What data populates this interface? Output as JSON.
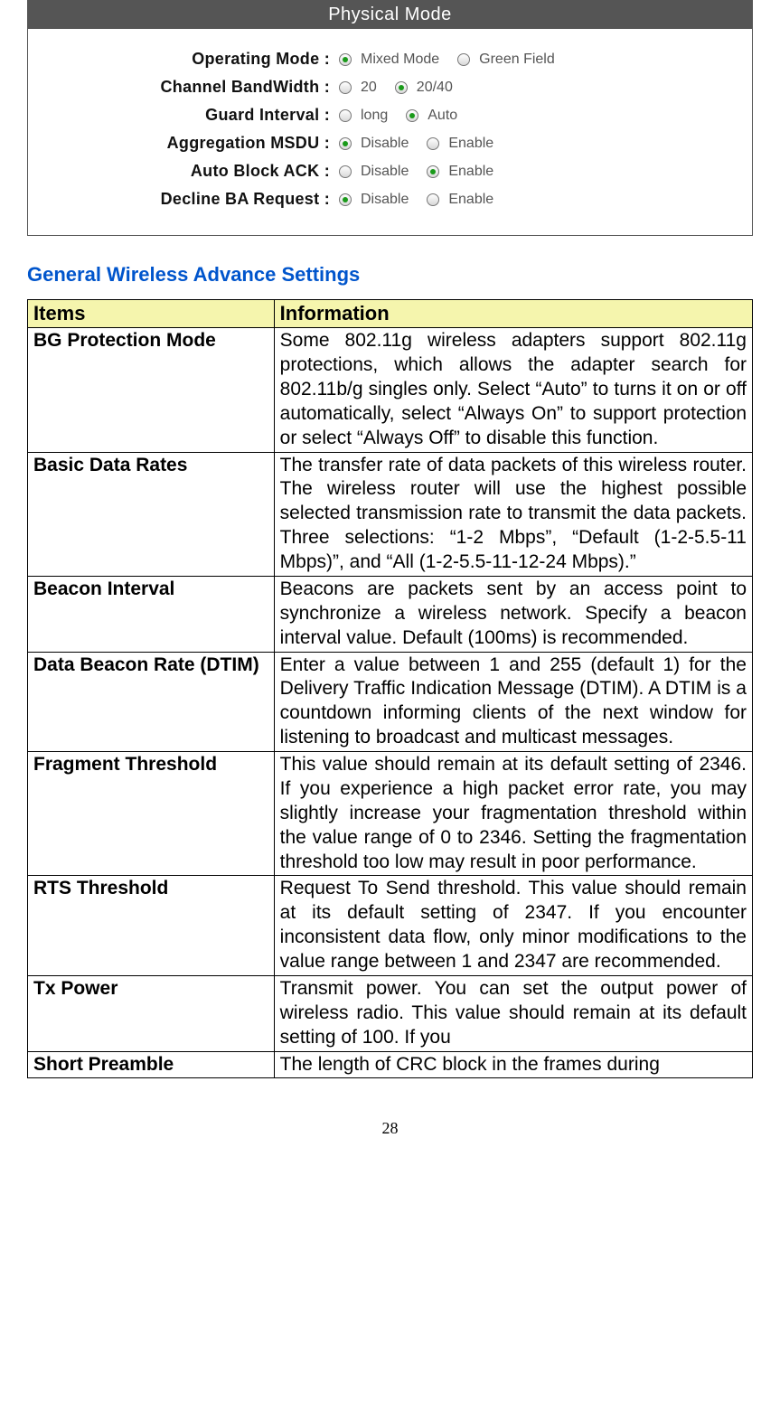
{
  "panel": {
    "title": "Physical Mode",
    "rows": [
      {
        "label": "Operating Mode :",
        "options": [
          {
            "label": "Mixed Mode",
            "checked": true
          },
          {
            "label": "Green Field",
            "checked": false
          }
        ]
      },
      {
        "label": "Channel BandWidth :",
        "options": [
          {
            "label": "20",
            "checked": false
          },
          {
            "label": "20/40",
            "checked": true
          }
        ]
      },
      {
        "label": "Guard Interval :",
        "options": [
          {
            "label": "long",
            "checked": false
          },
          {
            "label": "Auto",
            "checked": true
          }
        ]
      },
      {
        "label": "Aggregation MSDU :",
        "options": [
          {
            "label": "Disable",
            "checked": true
          },
          {
            "label": "Enable",
            "checked": false
          }
        ]
      },
      {
        "label": "Auto Block ACK :",
        "options": [
          {
            "label": "Disable",
            "checked": false
          },
          {
            "label": "Enable",
            "checked": true
          }
        ]
      },
      {
        "label": "Decline BA Request :",
        "options": [
          {
            "label": "Disable",
            "checked": true
          },
          {
            "label": "Enable",
            "checked": false
          }
        ]
      }
    ]
  },
  "section_heading": "General Wireless Advance Settings",
  "table": {
    "headers": {
      "items": "Items",
      "info": "Information"
    },
    "rows": [
      {
        "item": "BG Protection Mode",
        "info": "Some 802.11g wireless adapters support 802.11g protections, which allows the adapter search for 802.11b/g singles only. Select “Auto” to turns it on or off automatically, select “Always On” to support protection or select “Always Off” to disable this function."
      },
      {
        "item": "Basic Data Rates",
        "info": "The transfer rate of data packets of this wireless router. The wireless router will use the highest possible selected transmission rate to transmit the data packets. Three selections: “1-2 Mbps”, “Default (1-2-5.5-11 Mbps)”, and “All (1-2-5.5-11-12-24 Mbps).”"
      },
      {
        "item": "Beacon Interval",
        "info": "Beacons are packets sent by an access point to synchronize a wireless network. Specify a beacon interval value. Default (100ms) is recommended."
      },
      {
        "item": "Data Beacon Rate (DTIM)",
        "info": "Enter a value between 1 and 255 (default 1) for the Delivery Traffic Indication Message (DTIM). A DTIM is a countdown informing clients of the next window for listening to broadcast and multicast messages."
      },
      {
        "item": "Fragment Threshold",
        "info": "This value should remain at its default setting of 2346. If you experience a high packet error rate, you may slightly increase your fragmentation threshold within the value range of 0 to 2346. Setting the fragmentation threshold too low may result in poor performance."
      },
      {
        "item": "RTS Threshold",
        "info": "Request To Send threshold. This value should remain at its default setting of 2347. If you encounter inconsistent data flow, only minor modifications to the value range between 1 and 2347 are recommended."
      },
      {
        "item": "Tx Power",
        "info": "Transmit power. You can set the output power of wireless radio. This value should remain at its default setting of 100. If you"
      },
      {
        "item": "Short Preamble",
        "info": "The length of CRC block in the frames during"
      }
    ]
  },
  "page_number": "28"
}
